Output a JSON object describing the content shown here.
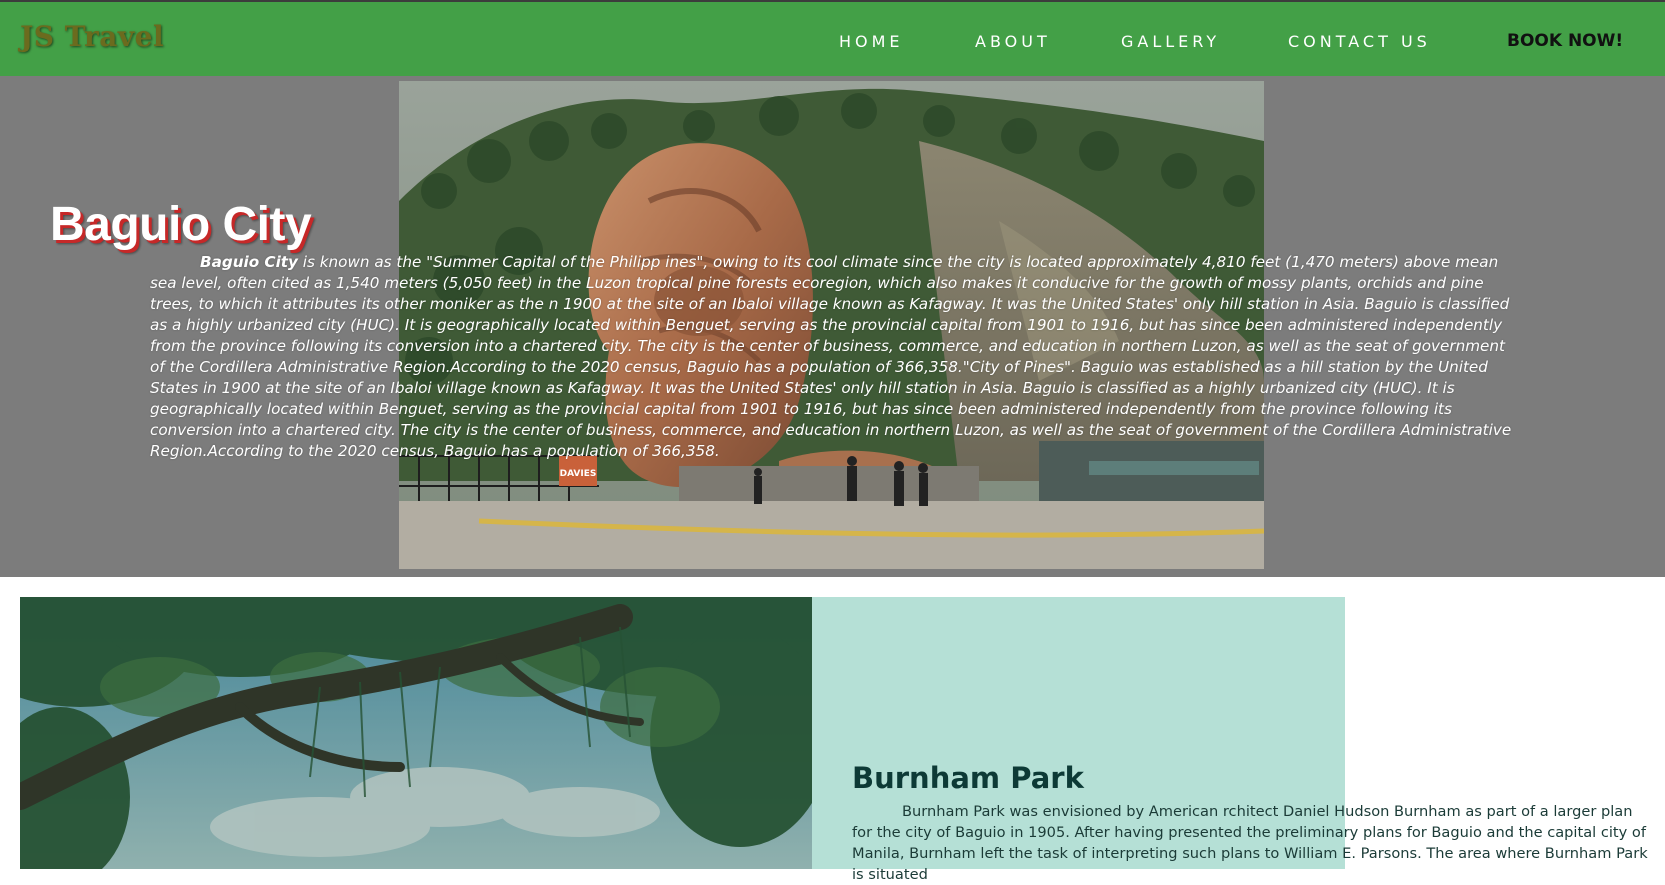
{
  "navbar": {
    "brand": "JS Travel",
    "links": [
      "HOME",
      "ABOUT",
      "GALLERY",
      "CONTACT US"
    ],
    "cta": "BOOK NOW!",
    "bg_color": "#43a047"
  },
  "hero": {
    "title": "Baguio City",
    "lead_bold": "Baguio City",
    "paragraph": " is known as the \"Summer Capital of the Philipp ines\", owing to its cool climate since the city is located approximately 4,810 feet (1,470 meters) above mean sea level, often cited as 1,540 meters (5,050 feet) in the Luzon tropical pine forests ecoregion, which also makes it conducive for the growth of mossy plants, orchids and pine trees, to which it attributes its other moniker as the n 1900 at the site of an Ibaloi village known as Kafagway. It was the United States' only hill station in Asia. Baguio is classified as a highly urbanized city (HUC). It is geographically located within Benguet, serving as the provincial capital from 1901 to 1916, but has since been administered independently from the province following its conversion into a chartered city. The city is the center of business, commerce, and education in northern Luzon, as well as the seat of government of the Cordillera Administrative Region.According to the 2020 census, Baguio has a population of 366,358.\"City of Pines\". Baguio was established as a hill station by the United States in 1900 at the site of an Ibaloi village known as Kafagway. It was the United States' only hill station in Asia. Baguio is classified as a highly urbanized city (HUC). It is geographically located within Benguet, serving as the provincial capital from 1901 to 1916, but has since been administered independently from the province following its conversion into a chartered city. The city is the center of business, commerce, and education in northern Luzon, as well as the seat of government of the Cordillera Administrative Region.According to the 2020 census, Baguio has a population of 366,358.",
    "sign_text": "DAVIES",
    "title_shadow_color": "#c62828"
  },
  "park": {
    "title": "Burnham Park",
    "paragraph": "Burnham Park was envisioned by American rchitect Daniel Hudson Burnham as part of a larger plan for the city of Baguio in 1905. After having presented the preliminary plans for Baguio and the capital city of Manila, Burnham left the task of interpreting such plans to William E. Parsons. The area where Burnham Park is situated",
    "panel_color": "#b5e0d6"
  }
}
